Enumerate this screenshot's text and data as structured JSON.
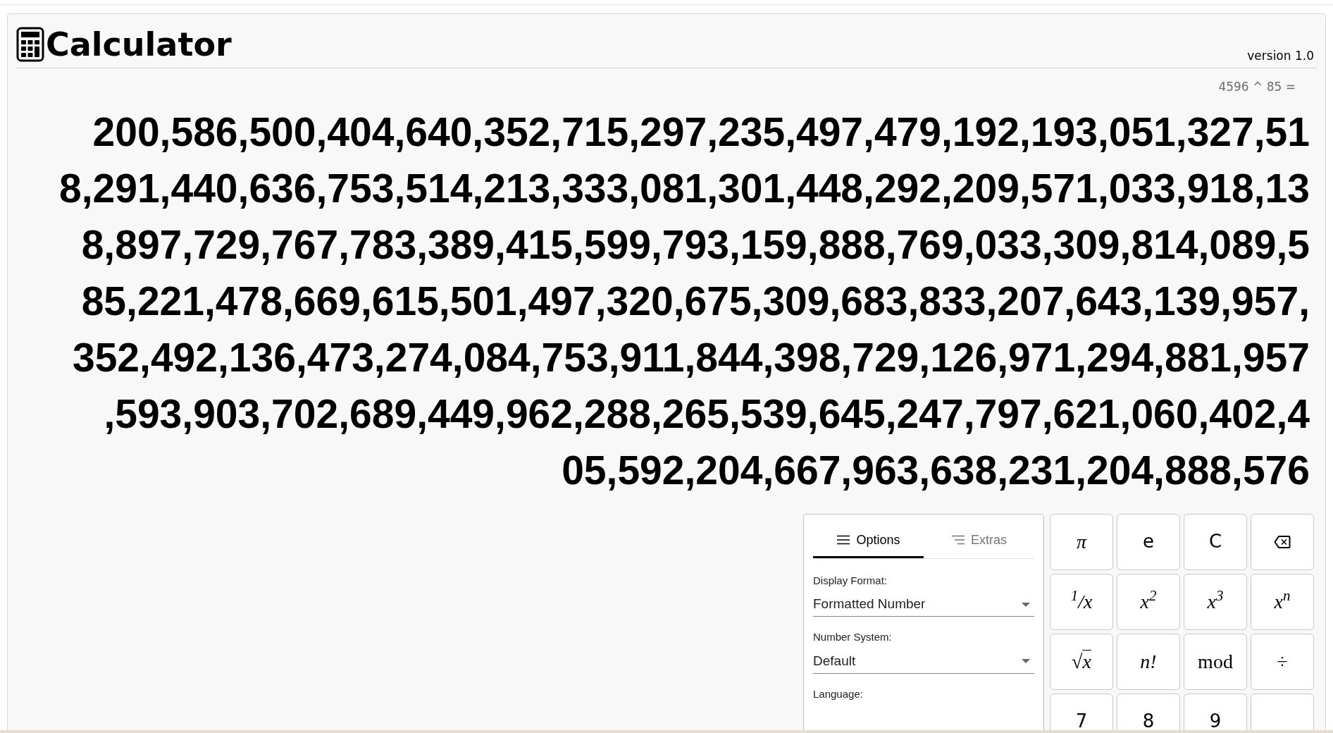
{
  "header": {
    "title": "Calculator",
    "version": "version 1.0"
  },
  "display": {
    "expression": "4596 ^ 85 =",
    "result_lines": [
      "200,586,500,404,640,352,715,297,235,497,479,192,193,051,327,51",
      "8,291,440,636,753,514,213,333,081,301,448,292,209,571,033,918,13",
      "8,897,729,767,783,389,415,599,793,159,888,769,033,309,814,089,5",
      "85,221,478,669,615,501,497,320,675,309,683,833,207,643,139,957,",
      "352,492,136,473,274,084,753,911,844,398,729,126,971,294,881,957",
      ",593,903,702,689,449,962,288,265,539,645,247,797,621,060,402,4",
      "05,592,204,667,963,638,231,204,888,576"
    ]
  },
  "options_panel": {
    "tabs": [
      {
        "label": "Options",
        "selected": true
      },
      {
        "label": "Extras",
        "selected": false
      }
    ],
    "fields": [
      {
        "label": "Display Format:",
        "value": "Formatted Number"
      },
      {
        "label": "Number System:",
        "value": "Default"
      },
      {
        "label": "Language:"
      }
    ]
  },
  "keypad": [
    {
      "kind": "math",
      "label": "π"
    },
    {
      "kind": "text",
      "label": "e"
    },
    {
      "kind": "text",
      "label": "C"
    },
    {
      "kind": "backspace"
    },
    {
      "kind": "math",
      "label": "$^{1}$/x"
    },
    {
      "kind": "math",
      "label": "x$^{2}$"
    },
    {
      "kind": "math",
      "label": "x$^{3}$"
    },
    {
      "kind": "math",
      "label": "x$^{n}$"
    },
    {
      "kind": "sqrt",
      "sign": "√",
      "label": "x"
    },
    {
      "kind": "math",
      "label": "n!"
    },
    {
      "kind": "serif",
      "label": "mod"
    },
    {
      "kind": "serif",
      "label": "÷"
    },
    {
      "kind": "text",
      "label": "7"
    },
    {
      "kind": "text",
      "label": "8"
    },
    {
      "kind": "text",
      "label": "9"
    },
    {
      "kind": "blank"
    }
  ]
}
